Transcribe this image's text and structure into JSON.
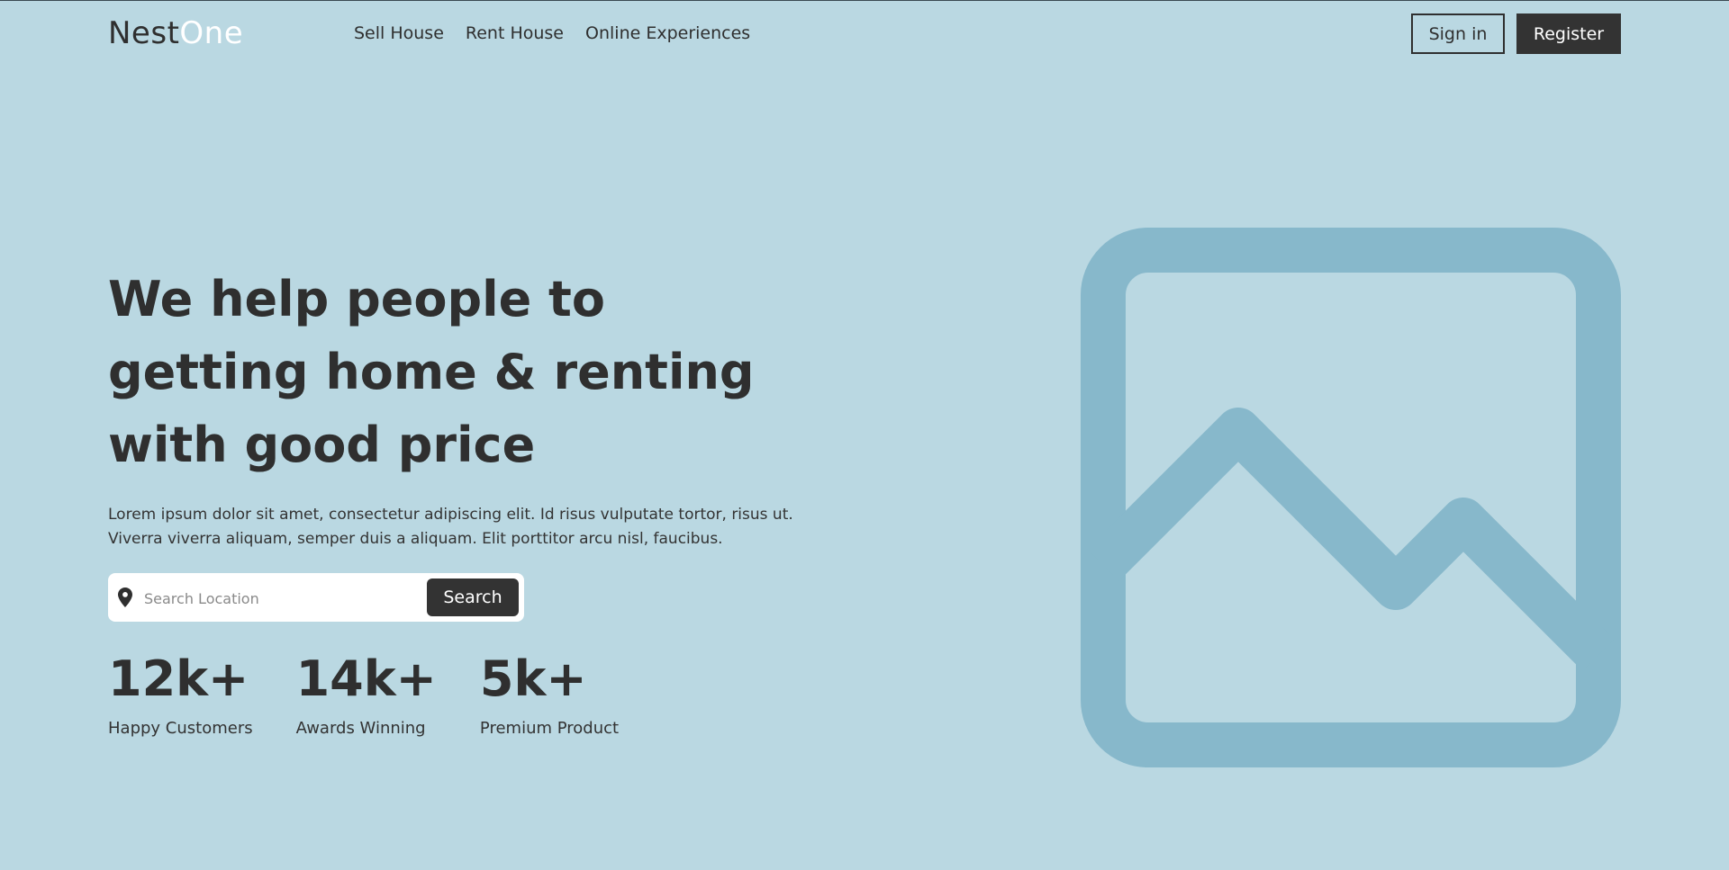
{
  "brand": {
    "logo_part1": "Nest",
    "logo_part2": "One"
  },
  "nav": {
    "items": [
      {
        "label": "Sell House"
      },
      {
        "label": "Rent House"
      },
      {
        "label": "Online Experiences"
      }
    ]
  },
  "auth": {
    "signin_label": "Sign in",
    "register_label": "Register"
  },
  "hero": {
    "headline": "We help people to getting home & renting with good price",
    "description": "Lorem ipsum dolor sit amet, consectetur adipiscing elit. Id risus vulputate tortor, risus ut. Viverra viverra aliquam, semper duis a aliquam. Elit porttitor arcu nisl, faucibus.",
    "search": {
      "placeholder": "Search Location",
      "value": "",
      "button_label": "Search",
      "icon": "location-pin-icon"
    },
    "stats": [
      {
        "value": "12k+",
        "label": "Happy Customers"
      },
      {
        "value": "14k+",
        "label": "Awards Winning"
      },
      {
        "value": "5k+",
        "label": "Premium Product"
      }
    ],
    "image_icon": "image-placeholder-icon"
  },
  "colors": {
    "background": "#bad8e2",
    "dark": "#333333",
    "logo_accent": "#ffffff",
    "placeholder_icon": "#87b8cb"
  }
}
